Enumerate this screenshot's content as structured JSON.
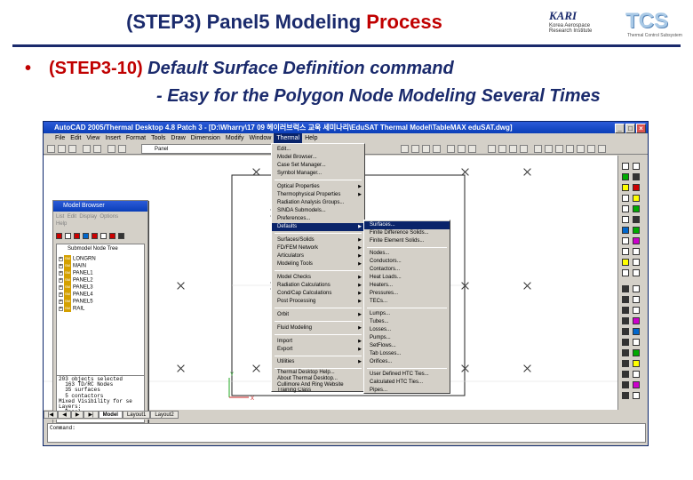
{
  "slide": {
    "title_part1": "(STEP3) Panel5 Modeling ",
    "title_part2": "Process",
    "logo_kari": "KARI",
    "logo_kari_sub": "Korea Aerospace Research Institute",
    "logo_tcs": "TCS",
    "logo_tcs_sub": "Thermal Control Subsystem",
    "bullet_dot": "•",
    "bullet_step": "(STEP3-10)",
    "bullet_cmd": " Default Surface Definition command",
    "bullet_sub": "- Easy for the Polygon Node Modeling Several Times"
  },
  "window": {
    "title": "AutoCAD 2005/Thermal Desktop 4.8 Patch 3 - [D:\\Wharry\\17 09 헤이러브럭스 교욱 세미나리\\EduSAT Thermal Model\\TableMAX eduSAT.dwg]",
    "btn_min": "_",
    "btn_max": "□",
    "btn_close": "×"
  },
  "menubar": [
    "File",
    "Edit",
    "View",
    "Insert",
    "Format",
    "Tools",
    "Draw",
    "Dimension",
    "Modify",
    "Window",
    "Thermal",
    "Help"
  ],
  "toolbar": {
    "layer": "Panel"
  },
  "browser": {
    "title": "Model Browser",
    "menu": [
      "List",
      "Edit",
      "Display",
      "Options",
      "Help"
    ],
    "tree_header": "Submodel Node Tree",
    "tree": [
      "LONGRN",
      "MAIN",
      "PANEL1",
      "PANEL2",
      "PANEL3",
      "PANEL4",
      "PANEL5",
      "RAIL"
    ],
    "tree_tag": "SM",
    "status": "203 objects selected\n  163 TD/RC Nodes\n  35 surfaces\n  5 contactors\nMixed Visibility for se\nLayers:\n  Panel"
  },
  "thermal_menu": [
    "Edit...",
    "Model Browser...",
    "Case Set Manager...",
    "Symbol Manager...",
    "Optical Properties",
    "Thermophysical Properties",
    "Radiation Analysis Groups...",
    "SINDA Submodels...",
    "Preferences...",
    "Defaults",
    "Surfaces/Solids",
    "FD/FEM Network",
    "Articulators",
    "Modeling Tools",
    "Model Checks",
    "Radiation Calculations",
    "Cond/Cap Calculations",
    "Post Processing",
    "Orbit",
    "Fluid Modeling",
    "Import",
    "Export",
    "Utilities",
    "Thermal Desktop Help...",
    "About Thermal Desktop...",
    "Cullimore And Ring Website",
    "Training Class"
  ],
  "defaults_menu": [
    "Surfaces...",
    "Finite Difference Solids...",
    "Finite Element Solids...",
    "Nodes...",
    "Conductors...",
    "Contactors...",
    "Heat Loads...",
    "Heaters...",
    "Pressures...",
    "TECs...",
    "Lumps...",
    "Tubes...",
    "Losses...",
    "Pumps...",
    "SetFlows...",
    "Tab Losses...",
    "Orifices...",
    "User Defined HTC Ties...",
    "Calculated HTC Ties...",
    "Pipes..."
  ],
  "tabs": [
    "Model",
    "Layout1",
    "Layout2"
  ],
  "command": {
    "label": "Command:"
  },
  "ucs": {
    "x": "X",
    "y": "Y"
  }
}
